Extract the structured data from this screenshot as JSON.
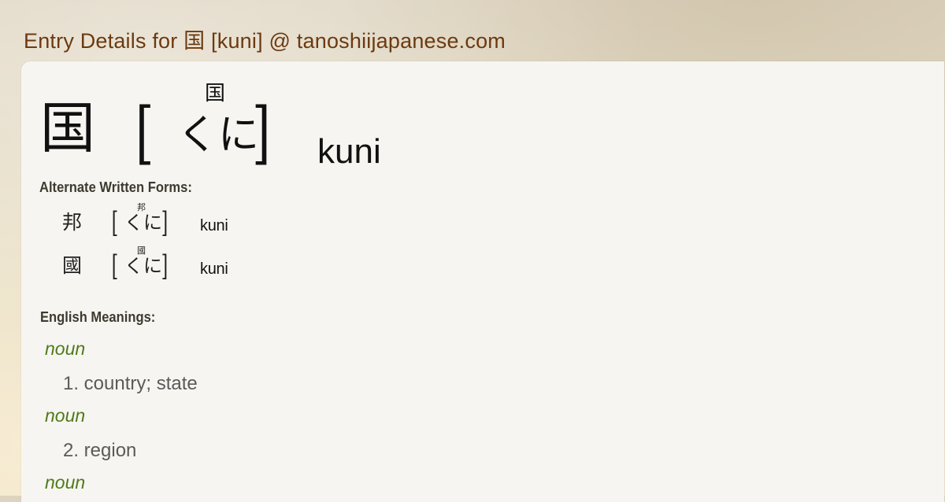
{
  "page_title": "Entry Details for 国 [kuni] @ tanoshiijapanese.com",
  "entry": {
    "kanji": "国",
    "bracket_open": "[",
    "bracket_close": "]",
    "kana": "くに",
    "furigana": "国",
    "romaji": "kuni"
  },
  "alternate": {
    "label": "Alternate Written Forms:",
    "forms": [
      {
        "kanji": "邦",
        "kana": "くに",
        "furigana": "邦",
        "romaji": "kuni"
      },
      {
        "kanji": "國",
        "kana": "くに",
        "furigana": "國",
        "romaji": "kuni"
      }
    ]
  },
  "meanings": {
    "label": "English Meanings:",
    "items": [
      {
        "pos": "noun",
        "text": "1. country; state"
      },
      {
        "pos": "noun",
        "text": "2. region"
      },
      {
        "pos": "noun",
        "text": ""
      }
    ]
  },
  "colors": {
    "title": "#6b3a10",
    "pos": "#4f7a1a",
    "meaning": "#5a5a5a",
    "card": "#f6f5f1"
  }
}
